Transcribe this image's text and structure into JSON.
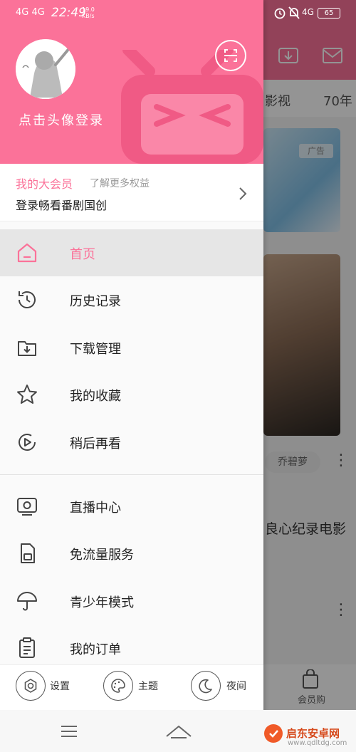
{
  "status_bar": {
    "network_left": "4G 4G",
    "time": "22:49",
    "speed_value": "19.0",
    "speed_unit": "KB/s",
    "network_right": "4G",
    "battery": "65"
  },
  "background": {
    "tabs": [
      "影视",
      "70年"
    ],
    "ad_label": "广告",
    "chip": "乔碧萝",
    "video_title": "良心纪录电影",
    "shop_label": "会员购"
  },
  "drawer": {
    "login_text": "点击头像登录",
    "vip": {
      "title": "我的大会员",
      "more": "了解更多权益",
      "subtitle": "登录畅看番剧国创"
    },
    "menu": [
      {
        "label": "首页",
        "icon": "home-icon",
        "active": true
      },
      {
        "label": "历史记录",
        "icon": "history-icon"
      },
      {
        "label": "下载管理",
        "icon": "download-folder-icon"
      },
      {
        "label": "我的收藏",
        "icon": "star-icon"
      },
      {
        "label": "稍后再看",
        "icon": "watch-later-icon"
      },
      {
        "label": "直播中心",
        "icon": "live-tv-icon"
      },
      {
        "label": "免流量服务",
        "icon": "sim-card-icon"
      },
      {
        "label": "青少年模式",
        "icon": "umbrella-icon"
      },
      {
        "label": "我的订单",
        "icon": "order-clipboard-icon"
      }
    ],
    "footer": [
      {
        "label": "设置",
        "icon": "settings-icon"
      },
      {
        "label": "主题",
        "icon": "palette-icon"
      },
      {
        "label": "夜间",
        "icon": "moon-icon"
      }
    ]
  },
  "watermark": {
    "text": "启东安卓网",
    "url": "www.qdltdg.com"
  },
  "colors": {
    "accent": "#fb7299",
    "text": "#222222",
    "muted": "#999999"
  }
}
